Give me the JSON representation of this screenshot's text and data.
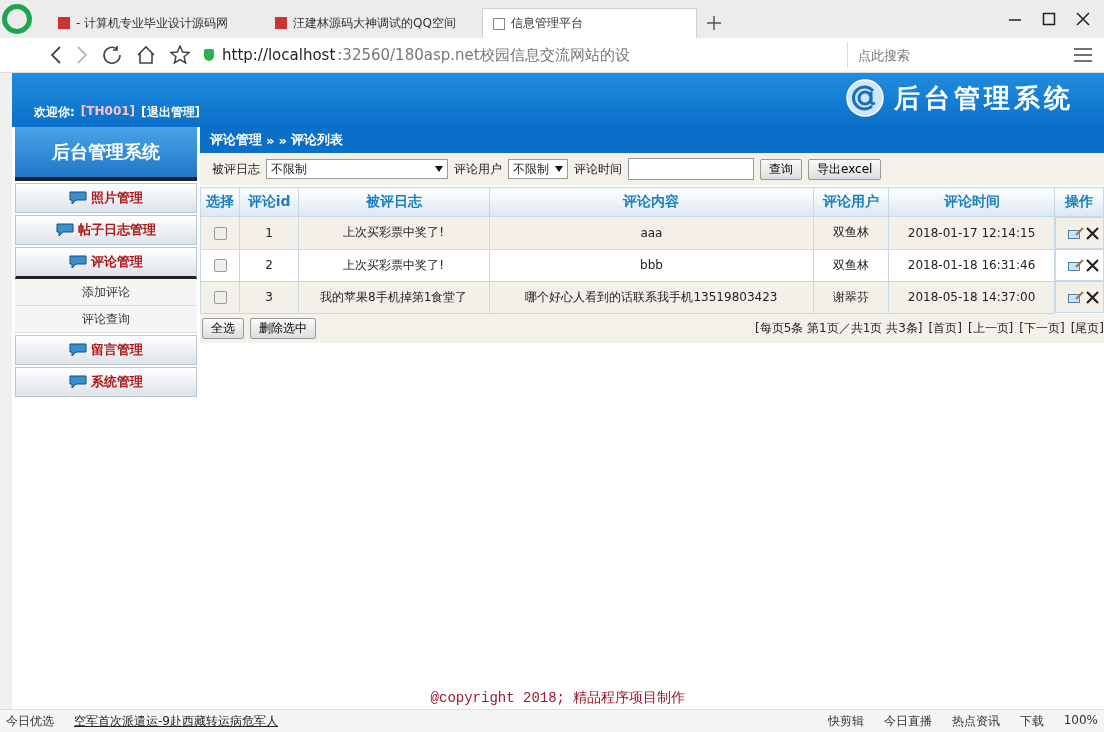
{
  "browser": {
    "tabs": [
      {
        "title": "- 计算机专业毕业设计源码网",
        "selected": false
      },
      {
        "title": "汪建林源码大神调试的QQ空间",
        "selected": false
      },
      {
        "title": "信息管理平台",
        "selected": true
      }
    ],
    "address": {
      "host": "http://localhost",
      "rest": ":32560/180asp.net校园信息交流网站的设"
    },
    "search": {
      "placeholder": "点此搜索"
    }
  },
  "header": {
    "welcome": "欢迎你:",
    "user": "[TH001]",
    "logout": "[退出管理]",
    "title": "后台管理系统"
  },
  "sidebar": {
    "title": "后台管理系统",
    "items": [
      {
        "label": "照片管理",
        "expanded": false
      },
      {
        "label": "帖子日志管理",
        "expanded": false
      },
      {
        "label": "评论管理",
        "expanded": true,
        "children": [
          {
            "label": "添加评论"
          },
          {
            "label": "评论查询"
          }
        ]
      },
      {
        "label": "留言管理",
        "expanded": false
      },
      {
        "label": "系统管理",
        "expanded": false
      }
    ]
  },
  "breadcrumb": [
    "评论管理",
    "»",
    "»",
    "评论列表"
  ],
  "filters": {
    "post_label": "被评日志",
    "post_value": "不限制",
    "user_label": "评论用户",
    "user_value": "不限制",
    "time_label": "评论时间",
    "query_button": "查询",
    "export_button": "导出excel"
  },
  "table": {
    "columns": [
      "选择",
      "评论id",
      "被评日志",
      "评论内容",
      "评论用户",
      "评论时间",
      "操作"
    ],
    "rows": [
      {
        "checked": false,
        "id": "1",
        "post": "上次买彩票中奖了!",
        "content": "aaa",
        "user": "双鱼林",
        "time": "2018-01-17 12:14:15"
      },
      {
        "checked": false,
        "id": "2",
        "post": "上次买彩票中奖了!",
        "content": "bbb",
        "user": "双鱼林",
        "time": "2018-01-18 16:31:46"
      },
      {
        "checked": false,
        "id": "3",
        "post": "我的苹果8手机掉第1食堂了",
        "content": "哪个好心人看到的话联系我手机13519803423",
        "user": "谢翠芬",
        "time": "2018-05-18 14:37:00"
      }
    ]
  },
  "actions": {
    "select_all": "全选",
    "delete_selected": "删除选中"
  },
  "pagination": {
    "summary": "[每页5条 第1页／共1页 共3条]",
    "links": [
      "[首页]",
      "[上一页]",
      "[下一页]",
      "[尾页]"
    ]
  },
  "footer": "@copyright 2018; 精品程序项目制作",
  "status_bar": {
    "left": "今日优选",
    "news": "空军首次派遣运-9赴西藏转运病危军人",
    "items": [
      "快剪辑",
      "今日直播",
      "热点资讯",
      "下载"
    ],
    "zoom": "100%"
  }
}
